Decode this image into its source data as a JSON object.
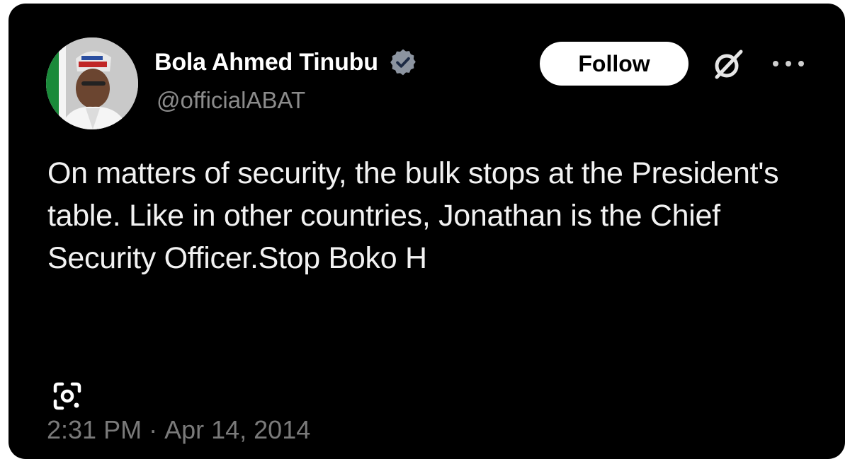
{
  "tweet": {
    "author": {
      "display_name": "Bola Ahmed Tinubu",
      "handle": "@officialABAT",
      "verified": true,
      "avatar": "profile-photo"
    },
    "follow_label": "Follow",
    "text": "On matters of security, the bulk stops at the President's table. Like in other countries, Jonathan is the Chief Security Officer.Stop Boko H",
    "time": "2:31 PM",
    "separator": "·",
    "date": "Apr 14, 2014"
  },
  "icons": {
    "verified": "verified-badge-icon",
    "grok": "grok-icon",
    "more": "more-icon",
    "lens": "google-lens-icon"
  },
  "colors": {
    "card_background": "#000000",
    "text_primary": "#f2f2f2",
    "text_secondary": "#8b8b8b",
    "verified_badge": "#8c94a0",
    "follow_button_bg": "#ffffff"
  }
}
